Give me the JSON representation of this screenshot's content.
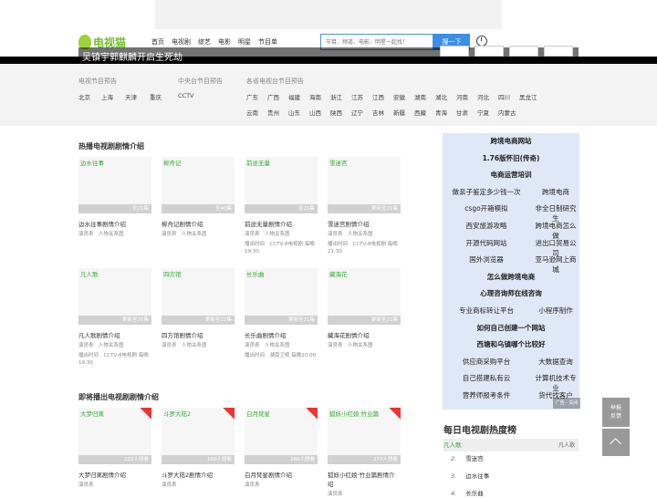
{
  "header": {
    "logo_text": "电视猫",
    "nav": [
      "首页",
      "电视剧",
      "综艺",
      "电影",
      "明星",
      "节目单"
    ],
    "search_placeholder": "节目、频道、电影、明星一起找！",
    "search_button": "搜一下"
  },
  "banner": {
    "headline": "吴镇宇郭麒麟开启生死劫",
    "thumbs": [
      "",
      "",
      "",
      ""
    ]
  },
  "tv_guide": {
    "local_title": "电视节目预告",
    "local_cities": [
      "北京",
      "上海",
      "天津",
      "重庆"
    ],
    "central_title": "中央台节目预告",
    "central_items": [
      "CCTV"
    ],
    "provincial_title": "各省电视台节目预告",
    "provincial_row1": [
      "广东",
      "广西",
      "福建",
      "海南",
      "浙江",
      "江苏",
      "江西",
      "安徽",
      "湖南",
      "湖北",
      "河南",
      "河北",
      "四川",
      "黑龙江"
    ],
    "provincial_row2": [
      "云南",
      "贵州",
      "山东",
      "山西",
      "陕西",
      "辽宁",
      "吉林",
      "新疆",
      "西藏",
      "青海",
      "甘肃",
      "宁夏",
      "内蒙古"
    ]
  },
  "hot": {
    "title": "热播电视剧剧情介绍",
    "row1": [
      {
        "alt": "边水往事",
        "cap": "全21集",
        "title": "边水往事剧情介绍",
        "sub1": "演员表　人物关系图",
        "sub2": ""
      },
      {
        "alt": "柳舟记",
        "cap": "全40集",
        "title": "柳舟记剧情介绍",
        "sub1": "演员表　人物关系图",
        "sub2": ""
      },
      {
        "alt": "前途无量",
        "cap": "全21集",
        "title": "前途无量剧情介绍",
        "sub1": "演员表　人物关系图",
        "sub2": "播出时间　CCTV-8电视剧 每晚19:30"
      },
      {
        "alt": "雪迷宫",
        "cap": "更新至31集",
        "title": "雪迷宫剧情介绍",
        "sub1": "演员表　人物关系图",
        "sub2": "播出时间　CCTV-8电视剧 每晚21:30"
      }
    ],
    "row2": [
      {
        "alt": "凡人歌",
        "cap": "更新至20集",
        "title": "凡人歌剧情介绍",
        "sub1": "演员表　人物关系图",
        "sub2": "播出时间　CCTV-8电视剧 每晚19:30"
      },
      {
        "alt": "四方馆",
        "cap": "更新至21集",
        "title": "四方馆剧情介绍",
        "sub1": "演员表　人物关系图",
        "sub2": ""
      },
      {
        "alt": "长乐曲",
        "cap": "更新至21集",
        "title": "长乐曲剧情介绍",
        "sub1": "演员表　人物关系图",
        "sub2": "播出时间　湖南卫视 每晚20:00"
      },
      {
        "alt": "藏海花",
        "cap": "更新至21集",
        "title": "藏海花剧情介绍",
        "sub1": "演员表　人物关系图",
        "sub2": ""
      }
    ]
  },
  "upcoming": {
    "title": "即将播出电视剧剧情介绍",
    "row": [
      {
        "alt": "大梦归离",
        "cap": "222人想看",
        "title": "大梦归离剧情介绍",
        "sub1": "演员表",
        "sub2": ""
      },
      {
        "alt": "斗罗大陆2",
        "cap": "160人想看",
        "title": "斗罗大陆2剧情介绍",
        "sub1": "演员表",
        "sub2": ""
      },
      {
        "alt": "白月梵星",
        "cap": "280人想看",
        "title": "白月梵星剧情介绍",
        "sub1": "演员表",
        "sub2": ""
      },
      {
        "alt": "狐妖小红娘·竹业篇",
        "cap": "277人想看",
        "title": "狐妖小红娘·竹业篇剧情介绍",
        "sub1": "演员表",
        "sub2": ""
      }
    ]
  },
  "sidebar": {
    "single": [
      "跨境电商网站",
      "1.76版怀旧(传奇)",
      "电商运营培训"
    ],
    "pairs": [
      [
        "做亲子鉴定多少钱一次",
        "跨境电商"
      ],
      [
        "csgo开箱模拟",
        "非全日制研究生"
      ],
      [
        "西安旅游攻略",
        "跨境电商怎么做"
      ],
      [
        "开源代码网站",
        "进出口贸易公司"
      ],
      [
        "国外浏览器",
        "亚马逊网上商城"
      ]
    ],
    "single2": [
      "怎么做跨境电商",
      "心理咨询师在线咨询"
    ],
    "pairs2": [
      [
        "专业商标转让平台",
        "小程序制作"
      ]
    ],
    "single3": [
      "如何自己创建一个网站",
      "西塘和乌镇哪个比较好"
    ],
    "pairs3": [
      [
        "供应商采购平台",
        "大数据查询"
      ],
      [
        "自己搭建私有云",
        "计算机技术专业"
      ],
      [
        "营养师报考条件",
        "货代找客户"
      ]
    ],
    "photo_label": "广告 · 关闭"
  },
  "feedback": "举报\n反馈",
  "ranking": {
    "title": "每日电视剧热度榜",
    "top_alt": "凡人歌",
    "top_right": "凡人歌",
    "items": [
      {
        "num": "2.",
        "name": "雪迷宫"
      },
      {
        "num": "3.",
        "name": "边水往事"
      },
      {
        "num": "4.",
        "name": "长乐曲"
      }
    ]
  }
}
